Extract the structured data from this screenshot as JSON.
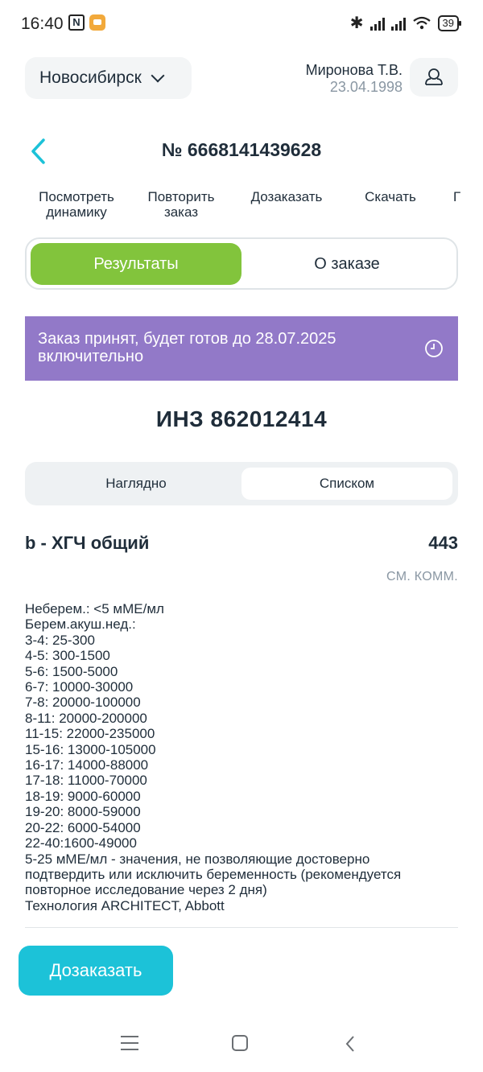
{
  "status_bar": {
    "time": "16:40",
    "battery": "39",
    "nfc_icon": "N"
  },
  "header": {
    "city": "Новосибирск",
    "user_name": "Миронова Т.В.",
    "user_dob": "23.04.1998"
  },
  "order": {
    "title": "№ 6668141439628",
    "actions": [
      {
        "label": "Посмотреть динамику",
        "line1": "Посмотреть",
        "line2": "динамику"
      },
      {
        "label": "Повторить заказ",
        "line1": "Повторить",
        "line2": "заказ"
      },
      {
        "label": "Дозаказать",
        "line1": "Дозаказать",
        "line2": ""
      },
      {
        "label": "Скачать",
        "line1": "Скачать",
        "line2": ""
      },
      {
        "label": "Г",
        "line1": "Г",
        "line2": ""
      }
    ],
    "tabs": {
      "results": "Результаты",
      "about": "О заказе",
      "active": "results"
    }
  },
  "banner": {
    "text": "Заказ принят, будет готов до 28.07.2025 включительно",
    "color": "#9279c8"
  },
  "inz": "ИНЗ 862012414",
  "view_toggle": {
    "visual": "Наглядно",
    "list": "Списком",
    "active": "list"
  },
  "result": {
    "name": "b - ХГЧ общий",
    "value": "443",
    "note": "СМ. КОММ.",
    "reference_lines": [
      "Неберем.: <5 мМЕ/мл",
      "Берем.акуш.нед.:",
      "3-4: 25-300",
      "4-5: 300-1500",
      "5-6: 1500-5000",
      "6-7: 10000-30000",
      "7-8: 20000-100000",
      "8-11: 20000-200000",
      "11-15: 22000-235000",
      "15-16: 13000-105000",
      "16-17: 14000-88000",
      "17-18: 11000-70000",
      "18-19: 9000-60000",
      "19-20: 8000-59000",
      "20-22: 6000-54000",
      "22-40:1600-49000",
      "5-25 мМЕ/мл - значения, не позволяющие достоверно",
      "подтвердить или исключить беременность (рекомендуется",
      "повторное исследование через 2 дня)",
      "Технология ARCHITECT, Abbott"
    ]
  },
  "order_more_button": "Дозаказать",
  "colors": {
    "accent_green": "#82c43c",
    "accent_cyan": "#1cc2d8",
    "text": "#1f2d3a",
    "muted": "#8a97a3"
  }
}
